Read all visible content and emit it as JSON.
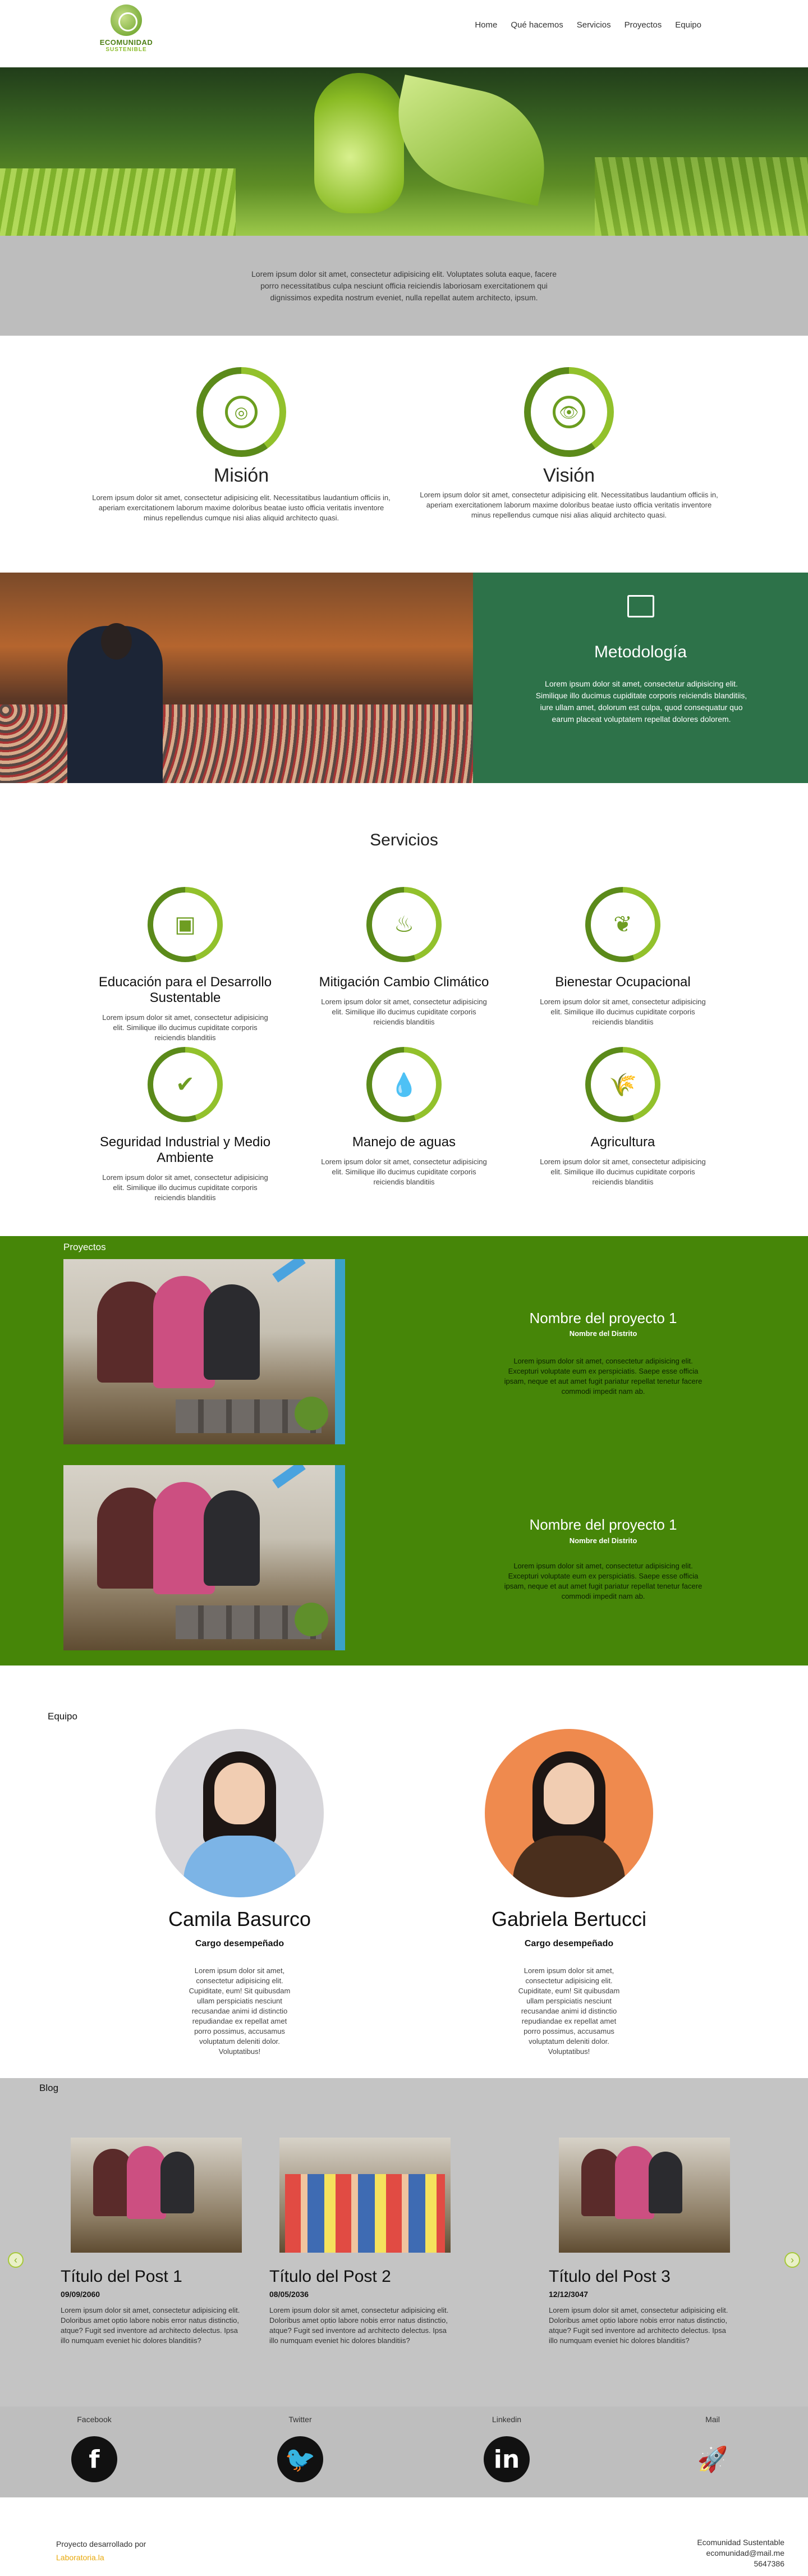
{
  "header": {
    "logo_line1": "ECOMUNIDAD",
    "logo_line2": "SUSTENIBLE",
    "nav": [
      "Home",
      "Qué hacemos",
      "Servicios",
      "Proyectos",
      "Equipo"
    ]
  },
  "intro": {
    "text": "Lorem ipsum dolor sit amet, consectetur adipisicing elit. Voluptates soluta eaque, facere porro necessitatibus culpa nesciunt officia reiciendis laboriosam exercitationem qui dignissimos expedita nostrum eveniet, nulla repellat autem architecto, ipsum."
  },
  "mision": {
    "title": "Misión",
    "text": "Lorem ipsum dolor sit amet, consectetur adipisicing elit. Necessitatibus laudantium officiis in, aperiam exercitationem laborum maxime doloribus beatae iusto officia veritatis inventore minus repellendus cumque nisi alias aliquid architecto quasi."
  },
  "vision": {
    "title": "Visión",
    "text": "Lorem ipsum dolor sit amet, consectetur adipisicing elit. Necessitatibus laudantium officiis in, aperiam exercitationem laborum maxime doloribus beatae iusto officia veritatis inventore minus repellendus cumque nisi alias aliquid architecto quasi."
  },
  "metodologia": {
    "title": "Metodología",
    "text": "Lorem ipsum dolor sit amet, consectetur adipisicing elit. Similique illo ducimus cupiditate corporis reiciendis blanditiis, iure ullam amet, dolorum est culpa, quod consequatur quo earum placeat voluptatem repellat dolores dolorem."
  },
  "servicios": {
    "title": "Servicios",
    "items": [
      {
        "title": "Educación para el Desarrollo Sustentable",
        "text": "Lorem ipsum dolor sit amet, consectetur adipisicing elit. Similique illo ducimus cupiditate corporis reiciendis blanditiis"
      },
      {
        "title": "Mitigación Cambio Climático",
        "text": "Lorem ipsum dolor sit amet, consectetur adipisicing elit. Similique illo ducimus cupiditate corporis reiciendis blanditiis"
      },
      {
        "title": "Bienestar Ocupacional",
        "text": "Lorem ipsum dolor sit amet, consectetur adipisicing elit. Similique illo ducimus cupiditate corporis reiciendis blanditiis"
      },
      {
        "title": "Seguridad Industrial y Medio Ambiente",
        "text": "Lorem ipsum dolor sit amet, consectetur adipisicing elit. Similique illo ducimus cupiditate corporis reiciendis blanditiis"
      },
      {
        "title": "Manejo de aguas",
        "text": "Lorem ipsum dolor sit amet, consectetur adipisicing elit. Similique illo ducimus cupiditate corporis reiciendis blanditiis"
      },
      {
        "title": "Agricultura",
        "text": "Lorem ipsum dolor sit amet, consectetur adipisicing elit. Similique illo ducimus cupiditate corporis reiciendis blanditiis"
      }
    ]
  },
  "proyectos": {
    "label": "Proyectos",
    "items": [
      {
        "title": "Nombre del proyecto 1",
        "district": "Nombre del Distrito",
        "text": "Lorem ipsum dolor sit amet, consectetur adipisicing elit. Excepturi voluptate eum ex perspiciatis. Saepe esse officia ipsam, neque et aut amet fugit pariatur repellat tenetur facere commodi impedit nam ab."
      },
      {
        "title": "Nombre del proyecto 1",
        "district": "Nombre del Distrito",
        "text": "Lorem ipsum dolor sit amet, consectetur adipisicing elit. Excepturi voluptate eum ex perspiciatis. Saepe esse officia ipsam, neque et aut amet fugit pariatur repellat tenetur facere commodi impedit nam ab."
      }
    ]
  },
  "equipo": {
    "label": "Equipo",
    "members": [
      {
        "name": "Camila Basurco",
        "role": "Cargo desempeñado",
        "text": "Lorem ipsum dolor sit amet, consectetur adipisicing elit. Cupiditate, eum! Sit quibusdam ullam perspiciatis nesciunt recusandae animi id distinctio repudiandae ex repellat amet porro possimus, accusamus voluptatum deleniti dolor. Voluptatibus!"
      },
      {
        "name": "Gabriela Bertucci",
        "role": "Cargo desempeñado",
        "text": "Lorem ipsum dolor sit amet, consectetur adipisicing elit. Cupiditate, eum! Sit quibusdam ullam perspiciatis nesciunt recusandae animi id distinctio repudiandae ex repellat amet porro possimus, accusamus voluptatum deleniti dolor. Voluptatibus!"
      }
    ]
  },
  "blog": {
    "label": "Blog",
    "posts": [
      {
        "title": "Título del Post 1",
        "date": "09/09/2060",
        "text": "Lorem ipsum dolor sit amet, consectetur adipisicing elit. Doloribus amet optio labore nobis error natus distinctio, atque? Fugit sed inventore ad architecto delectus. Ipsa illo numquam eveniet hic dolores blanditiis?"
      },
      {
        "title": "Título del Post 2",
        "date": "08/05/2036",
        "text": "Lorem ipsum dolor sit amet, consectetur adipisicing elit. Doloribus amet optio labore nobis error natus distinctio, atque? Fugit sed inventore ad architecto delectus. Ipsa illo numquam eveniet hic dolores blanditiis?"
      },
      {
        "title": "Título del Post 3",
        "date": "12/12/3047",
        "text": "Lorem ipsum dolor sit amet, consectetur adipisicing elit. Doloribus amet optio labore nobis error natus distinctio, atque? Fugit sed inventore ad architecto delectus. Ipsa illo numquam eveniet hic dolores blanditiis?"
      }
    ],
    "prev_glyph": "‹",
    "next_glyph": "›"
  },
  "social": {
    "items": [
      {
        "label": "Facebook",
        "glyph": "f",
        "icon": "facebook-icon"
      },
      {
        "label": "Twitter",
        "glyph": "🐦",
        "icon": "twitter-icon"
      },
      {
        "label": "Linkedin",
        "glyph": "in",
        "icon": "linkedin-icon"
      },
      {
        "label": "Mail",
        "glyph": "🚀",
        "icon": "rocket-icon"
      }
    ]
  },
  "footer": {
    "dev_text": "Proyecto desarrollado por",
    "dev_link": "Laboratoria.la",
    "org": "Ecomunidad Sustentable",
    "email": "ecomunidad@mail.me",
    "phone": "5647386"
  },
  "colors": {
    "accent": "#92c12c",
    "accent_dark": "#5b8a1a",
    "projects_bg": "#468608",
    "metodologia_bg": "#2d7249",
    "link": "#e8a90d"
  }
}
